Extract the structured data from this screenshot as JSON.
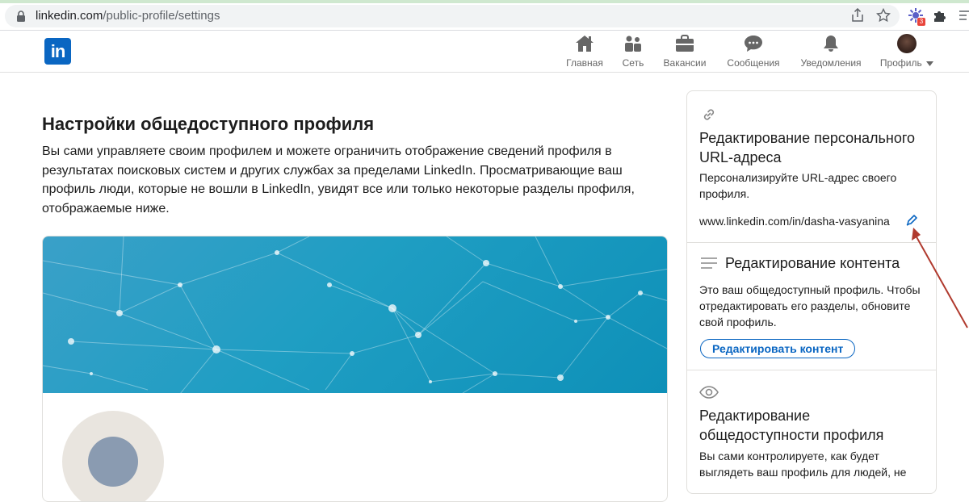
{
  "browser": {
    "url_host": "linkedin.com",
    "url_path": "/public-profile/settings",
    "extension_badge": "3"
  },
  "nav": {
    "items": [
      {
        "label": "Главная",
        "icon": "home-icon"
      },
      {
        "label": "Сеть",
        "icon": "network-icon"
      },
      {
        "label": "Вакансии",
        "icon": "briefcase-icon"
      },
      {
        "label": "Сообщения",
        "icon": "messaging-icon"
      },
      {
        "label": "Уведомления",
        "icon": "bell-icon"
      },
      {
        "label": "Профиль",
        "icon": "avatar"
      }
    ]
  },
  "main": {
    "title": "Настройки общедоступного профиля",
    "description": "Вы сами управляете своим профилем и можете ограничить отображение сведений профиля в результатах поисковых систем и других службах за пределами LinkedIn. Просматривающие ваш профиль люди, которые не вошли в LinkedIn, увидят все или только некоторые разделы профиля, отображаемые ниже."
  },
  "rail": {
    "url_section": {
      "title": "Редактирование персонального URL-адреса",
      "body": "Персонализируйте URL-адрес своего профиля.",
      "url": "www.linkedin.com/in/dasha-vasyanina"
    },
    "content_section": {
      "title": "Редактирование контента",
      "body": "Это ваш общедоступный профиль. Чтобы отредактировать его разделы, обновите свой профиль.",
      "button": "Редактировать контент"
    },
    "visibility_section": {
      "title": "Редактирование общедоступности профиля",
      "body": "Вы сами контролируете, как будет выглядеть ваш профиль для людей, не"
    }
  },
  "colors": {
    "brand": "#0a66c2",
    "annotation_arrow": "#b03a2e"
  }
}
